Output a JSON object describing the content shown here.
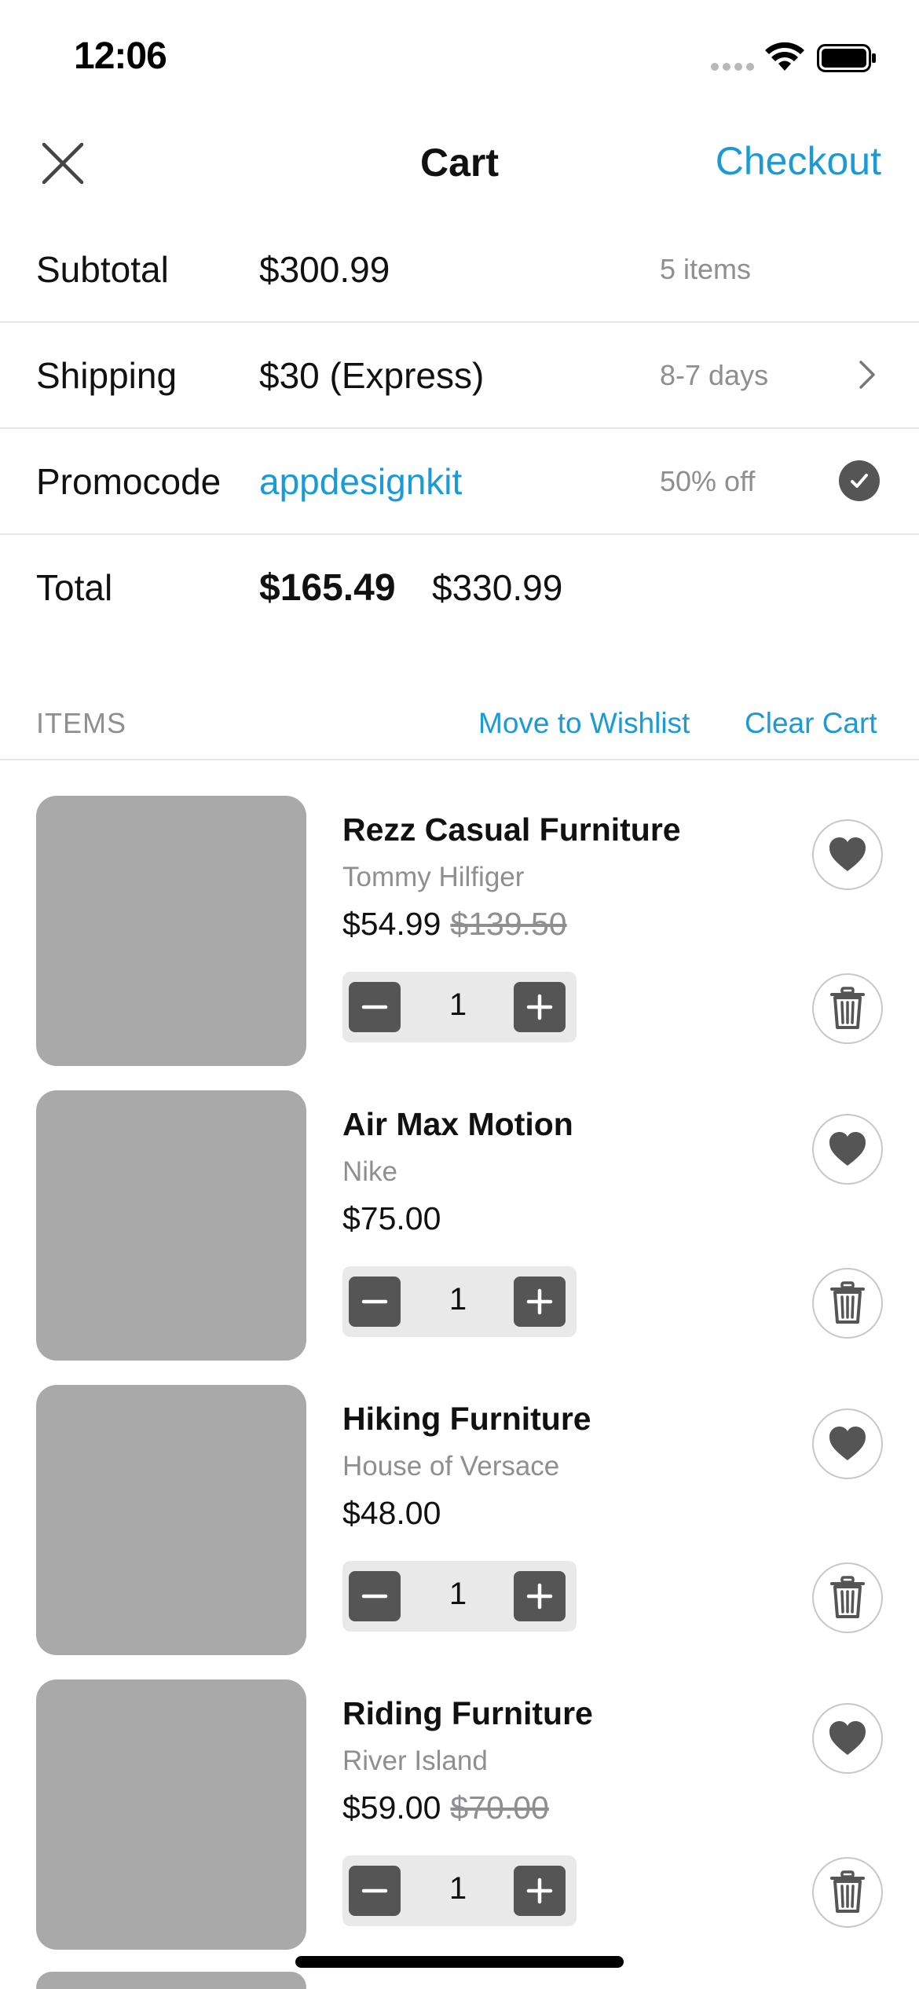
{
  "status_bar": {
    "time": "12:06"
  },
  "nav": {
    "title": "Cart",
    "checkout_label": "Checkout"
  },
  "summary": {
    "subtotal": {
      "label": "Subtotal",
      "value": "$300.99",
      "meta": "5 items"
    },
    "shipping": {
      "label": "Shipping",
      "value": "$30 (Express)",
      "meta": "8-7 days"
    },
    "promocode": {
      "label": "Promocode",
      "value": "appdesignkit",
      "meta": "50% off"
    },
    "total": {
      "label": "Total",
      "value": "$165.49",
      "original": "$330.99"
    }
  },
  "items_section": {
    "title": "ITEMS",
    "wishlist_label": "Move to Wishlist",
    "clear_label": "Clear Cart"
  },
  "products": [
    {
      "name": "Rezz Casual Furniture",
      "brand": "Tommy Hilfiger",
      "price": "$54.99",
      "old_price": "$139.50",
      "qty": "1"
    },
    {
      "name": "Air Max Motion",
      "brand": "Nike",
      "price": "$75.00",
      "old_price": "",
      "qty": "1"
    },
    {
      "name": "Hiking Furniture",
      "brand": "House of Versace",
      "price": "$48.00",
      "old_price": "",
      "qty": "1"
    },
    {
      "name": "Riding Furniture",
      "brand": "River Island",
      "price": "$59.00",
      "old_price": "$70.00",
      "qty": "1"
    }
  ],
  "colors": {
    "accent": "#1a9ad6",
    "muted": "#8e8e93",
    "dark_button": "#555555",
    "placeholder": "#a9a9a9"
  },
  "icons": [
    "close-icon",
    "chevron-right-icon",
    "checkmark-icon",
    "heart-icon",
    "trash-icon",
    "minus-icon",
    "plus-icon",
    "wifi-icon",
    "battery-icon"
  ]
}
